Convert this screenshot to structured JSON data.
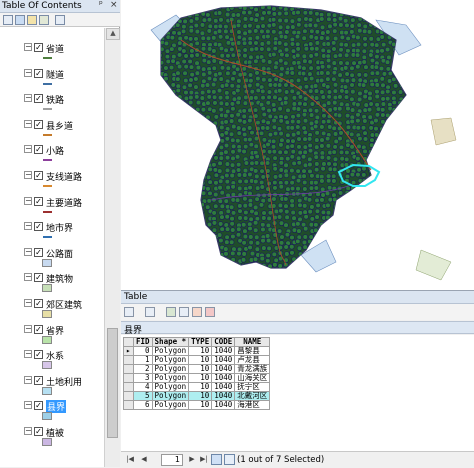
{
  "toc": {
    "title": "Table Of Contents",
    "title_controls": [
      "ᵖ",
      "×"
    ],
    "layers": [
      {
        "name": "省道",
        "symbol": "line",
        "color": "#4f7f3f"
      },
      {
        "name": "隧道",
        "symbol": "line",
        "color": "#3f6fa3"
      },
      {
        "name": "铁路",
        "symbol": "line",
        "color": "#a0a0a0"
      },
      {
        "name": "县乡道",
        "symbol": "line",
        "color": "#c57b2b"
      },
      {
        "name": "小路",
        "symbol": "line",
        "color": "#8c3f9c"
      },
      {
        "name": "支线道路",
        "symbol": "line",
        "color": "#d8892f"
      },
      {
        "name": "主要道路",
        "symbol": "line",
        "color": "#9c3030"
      },
      {
        "name": "地市界",
        "symbol": "line",
        "color": "#2f6fb0"
      },
      {
        "name": "公路面",
        "symbol": "box",
        "color": "#c8daf0"
      },
      {
        "name": "建筑物",
        "symbol": "box",
        "color": "#c7e0b8"
      },
      {
        "name": "郊区建筑",
        "symbol": "box",
        "color": "#e7dfa6"
      },
      {
        "name": "省界",
        "symbol": "box",
        "color": "#b9e3a9"
      },
      {
        "name": "水系",
        "symbol": "box",
        "color": "#d7c6e9"
      },
      {
        "name": "土地利用",
        "symbol": "box",
        "color": "#b6e0f2"
      },
      {
        "name": "县界",
        "symbol": "box",
        "color": "#9ed0e8",
        "selected": true
      },
      {
        "name": "植被",
        "symbol": "box",
        "color": "#cbb7e3"
      }
    ]
  },
  "table": {
    "window_title": "Table",
    "tab_label": "县界",
    "columns": [
      "FID",
      "Shape *",
      "TYPE",
      "CODE",
      "NAME"
    ],
    "rows": [
      {
        "FID": "0",
        "Shape": "Polygon",
        "TYPE": "10",
        "CODE": "1040",
        "NAME": "昌黎县",
        "current": true
      },
      {
        "FID": "1",
        "Shape": "Polygon",
        "TYPE": "10",
        "CODE": "1040",
        "NAME": "卢龙县"
      },
      {
        "FID": "2",
        "Shape": "Polygon",
        "TYPE": "10",
        "CODE": "1040",
        "NAME": "青龙满族"
      },
      {
        "FID": "3",
        "Shape": "Polygon",
        "TYPE": "10",
        "CODE": "1040",
        "NAME": "山海关区"
      },
      {
        "FID": "4",
        "Shape": "Polygon",
        "TYPE": "10",
        "CODE": "1040",
        "NAME": "抚宁区"
      },
      {
        "FID": "5",
        "Shape": "Polygon",
        "TYPE": "10",
        "CODE": "1040",
        "NAME": "北戴河区",
        "selected": true
      },
      {
        "FID": "6",
        "Shape": "Polygon",
        "TYPE": "10",
        "CODE": "1040",
        "NAME": "海港区"
      }
    ],
    "record_number": "1",
    "status": "(1 out of 7 Selected)"
  },
  "colors": {
    "map_fill": "#1f4d2a",
    "dot_fill": "#2e7d3c",
    "dot_outline": "#1b1b5a",
    "selected_outline": "#33e6f0",
    "selected_row": "#aeeef0"
  }
}
